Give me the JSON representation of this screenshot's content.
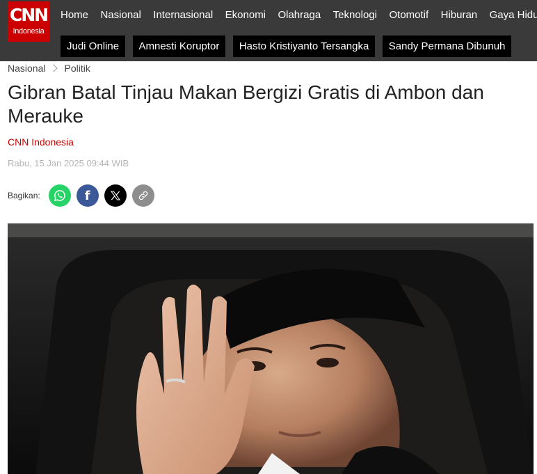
{
  "brand": {
    "logo_text": "CNN",
    "logo_subtitle": "Indonesia",
    "brand_red": "#cc0000"
  },
  "nav": {
    "items": [
      "Home",
      "Nasional",
      "Internasional",
      "Ekonomi",
      "Olahraga",
      "Teknologi",
      "Otomotif",
      "Hiburan",
      "Gaya Hidup"
    ]
  },
  "trending": {
    "tags": [
      "Judi Online",
      "Amnesti Koruptor",
      "Hasto Kristiyanto Tersangka",
      "Sandy Permana Dibunuh"
    ]
  },
  "breadcrumb": {
    "section": "Nasional",
    "subsection": "Politik"
  },
  "article": {
    "title": "Gibran Batal Tinjau Makan Bergizi Gratis di Ambon dan Merauke",
    "author": "CNN Indonesia",
    "date": "Rabu, 15 Jan 2025 09:44 WIB"
  },
  "share": {
    "label": "Bagikan:",
    "buttons": [
      "whatsapp-icon",
      "facebook-icon",
      "x-icon",
      "link-icon"
    ]
  }
}
